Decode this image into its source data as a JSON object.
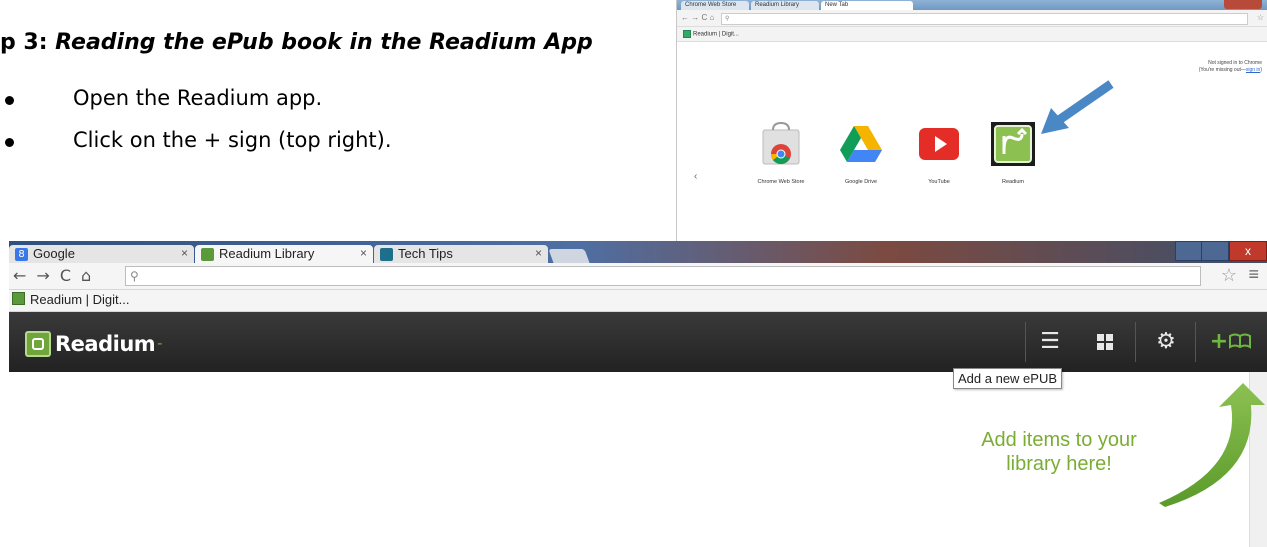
{
  "document": {
    "heading_step": "p 3: ",
    "heading_title": "Reading the ePub book in the Readium App",
    "steps": [
      "Open the Readium app.",
      "Click on the + sign (top right)."
    ]
  },
  "new_tab_screenshot": {
    "tabs": [
      "Chrome Web Store",
      "Readium Library",
      "New Tab"
    ],
    "bookmark": "Readium | Digit...",
    "signin_line1": "Not signed in to Chrome",
    "signin_line2_prefix": "(You're missing out—",
    "signin_link": "sign in",
    "signin_line2_suffix": ")",
    "apps": [
      {
        "label": "Chrome Web Store",
        "icon": "chrome-web-store-icon"
      },
      {
        "label": "Google Drive",
        "icon": "google-drive-icon"
      },
      {
        "label": "YouTube",
        "icon": "youtube-icon"
      },
      {
        "label": "Readium",
        "icon": "readium-icon"
      }
    ],
    "prev_page": "‹"
  },
  "library_screenshot": {
    "tabs": [
      {
        "label": "Google",
        "icon": "google-icon",
        "icon_text": "8",
        "color": "#3b78e7"
      },
      {
        "label": "Readium Library",
        "icon": "readium-icon",
        "icon_text": "",
        "color": "#5a9a3a"
      },
      {
        "label": "Tech Tips",
        "icon": "tech-tips-icon",
        "icon_text": "",
        "color": "#1e6f8c"
      }
    ],
    "tab_close": "×",
    "window_close": "x",
    "bookmark": "Readium | Digit...",
    "app_name": "Readium",
    "app_name_dash": "-",
    "tooltip": "Add a new ePUB",
    "callout": "Add items to your library here!",
    "accent_color": "#6fb63f"
  }
}
